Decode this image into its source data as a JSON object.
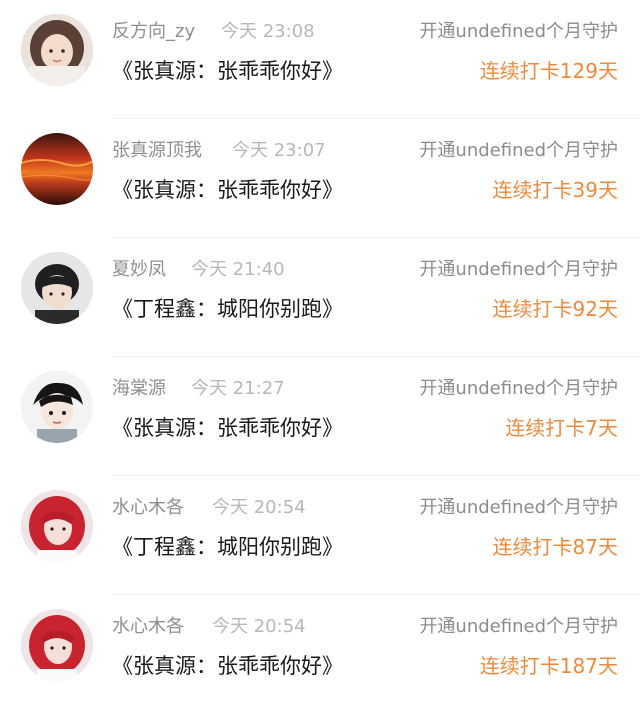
{
  "records": [
    {
      "user": "反方向_zy",
      "time": "今天 23:08",
      "guard": "开通undefined个月守护",
      "title": "《张真源：张乖乖你好》",
      "streak": "连续打卡129天",
      "avatar": "avatar-girl-light"
    },
    {
      "user": "张真源顶我",
      "time": "今天 23:07",
      "guard": "开通undefined个月守护",
      "title": "《张真源：张乖乖你好》",
      "streak": "连续打卡39天",
      "avatar": "avatar-sunset"
    },
    {
      "user": "夏妙凤",
      "time": "今天 21:40",
      "guard": "开通undefined个月守护",
      "title": "《丁程鑫：城阳你别跑》",
      "streak": "连续打卡92天",
      "avatar": "avatar-boy-dark-hair"
    },
    {
      "user": "海棠源",
      "time": "今天 21:27",
      "guard": "开通undefined个月守护",
      "title": "《张真源：张乖乖你好》",
      "streak": "连续打卡7天",
      "avatar": "avatar-boy-sketch"
    },
    {
      "user": "水心木各",
      "time": "今天 20:54",
      "guard": "开通undefined个月守护",
      "title": "《丁程鑫：城阳你别跑》",
      "streak": "连续打卡87天",
      "avatar": "avatar-redhair"
    },
    {
      "user": "水心木各",
      "time": "今天 20:54",
      "guard": "开通undefined个月守护",
      "title": "《张真源：张乖乖你好》",
      "streak": "连续打卡187天",
      "avatar": "avatar-redhair"
    }
  ],
  "colors": {
    "streak": "#ef8a3c",
    "name": "#8f8f8f",
    "time": "#b8b8b8",
    "title": "#1a1a1a"
  }
}
